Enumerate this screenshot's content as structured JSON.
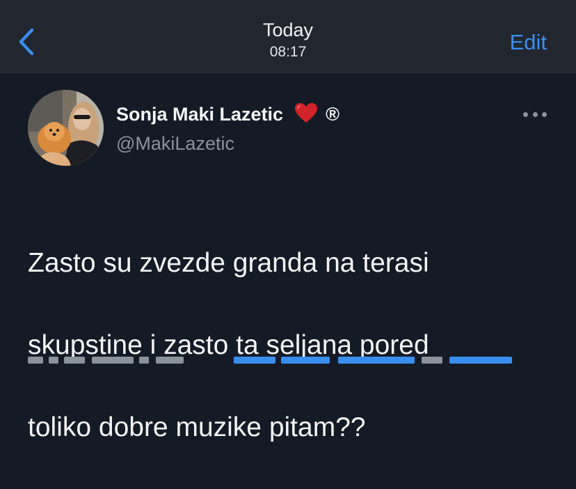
{
  "header": {
    "back_icon": "chevron-left-icon",
    "title": "Today",
    "time": "08:17",
    "edit_label": "Edit"
  },
  "tweet": {
    "author_name": "Sonja Maki Lazetic",
    "name_emoji": "❤️",
    "registered_mark": "®",
    "handle": "@MakiLazetic",
    "more_icon": "more-dots-icon",
    "text_line_1": "Zasto su zvezde granda na terasi",
    "text_line_2": "skupstine i zasto ta seljana pored",
    "text_line_3": "toliko dobre muzike pitam??"
  },
  "colors": {
    "background": "#151b26",
    "header_background": "#21262f",
    "accent": "#3a8ef0",
    "secondary_text": "#8a929c"
  }
}
